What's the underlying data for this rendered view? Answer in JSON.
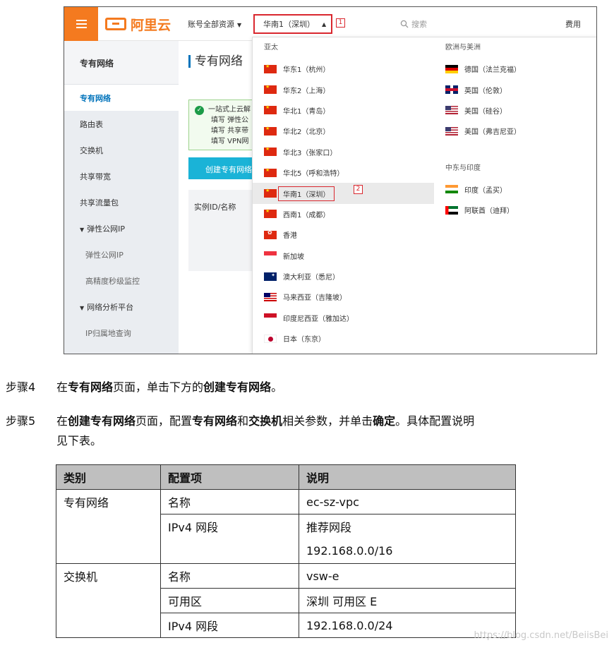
{
  "console": {
    "logo_text": "阿里云",
    "account_menu": "账号全部资源",
    "region_selector": "华南1（深圳）",
    "marker_1": "1",
    "marker_2": "2",
    "search_placeholder": "搜索",
    "fee_label": "费用",
    "brand_color": "#f47a1f",
    "sidebar": {
      "title": "专有网络",
      "items": [
        {
          "label": "专有网络",
          "active": true
        },
        {
          "label": "路由表"
        },
        {
          "label": "交换机"
        },
        {
          "label": "共享带宽"
        },
        {
          "label": "共享流量包"
        },
        {
          "label": "弹性公网IP",
          "group": true
        },
        {
          "label": "弹性公网IP",
          "sub": true
        },
        {
          "label": "高精度秒级监控",
          "sub": true
        },
        {
          "label": "网络分析平台",
          "group": true
        },
        {
          "label": "IP归属地查询",
          "sub": true
        }
      ]
    },
    "main": {
      "title": "专有网络",
      "notice_lines": [
        "一站式上云解",
        "填写 弹性公",
        "填写 共享带",
        "填写 VPN网"
      ],
      "create_button": "创建专有网络",
      "column_header": "实例ID/名称"
    },
    "dropdown": {
      "asia_title": "亚太",
      "asia": [
        {
          "label": "华东1（杭州）",
          "flag": "cn"
        },
        {
          "label": "华东2（上海）",
          "flag": "cn"
        },
        {
          "label": "华北1（青岛）",
          "flag": "cn"
        },
        {
          "label": "华北2（北京）",
          "flag": "cn"
        },
        {
          "label": "华北3（张家口）",
          "flag": "cn"
        },
        {
          "label": "华北5（呼和浩特）",
          "flag": "cn"
        },
        {
          "label": "华南1（深圳）",
          "flag": "cn",
          "selected": true
        },
        {
          "label": "西南1（成都）",
          "flag": "cn"
        },
        {
          "label": "香港",
          "flag": "hk"
        },
        {
          "label": "新加坡",
          "flag": "sg"
        },
        {
          "label": "澳大利亚（悉尼）",
          "flag": "au"
        },
        {
          "label": "马来西亚（吉隆坡）",
          "flag": "my"
        },
        {
          "label": "印度尼西亚（雅加达）",
          "flag": "id"
        },
        {
          "label": "日本（东京）",
          "flag": "jp"
        }
      ],
      "europe_title": "欧洲与美洲",
      "europe": [
        {
          "label": "德国（法兰克福）",
          "flag": "de"
        },
        {
          "label": "英国（伦敦）",
          "flag": "uk"
        },
        {
          "label": "美国（硅谷）",
          "flag": "us"
        },
        {
          "label": "美国（弗吉尼亚）",
          "flag": "us"
        }
      ],
      "mideast_title": "中东与印度",
      "mideast": [
        {
          "label": "印度（孟买）",
          "flag": "in"
        },
        {
          "label": "阿联酋（迪拜）",
          "flag": "ae"
        }
      ]
    }
  },
  "steps": {
    "step4": {
      "num": "步骤4",
      "t1": "在",
      "b1": "专有网络",
      "t2": "页面，单击下方的",
      "b2": "创建专有网络",
      "t3": "。"
    },
    "step5": {
      "num": "步骤5",
      "t1": "在",
      "b1": "创建专有网络",
      "t2": "页面，配置",
      "b2": "专有网络",
      "t3": "和",
      "b3": "交换机",
      "t4": "相关参数，并单击",
      "b4": "确定",
      "t5": "。具体配置说明",
      "line2": "见下表。"
    }
  },
  "table": {
    "headers": [
      "类别",
      "配置项",
      "说明"
    ],
    "rows": [
      {
        "cat": "专有网络",
        "item": "名称",
        "desc": "ec-sz-vpc"
      },
      {
        "cat": "",
        "item": "IPv4 网段",
        "desc": "推荐网段"
      },
      {
        "cat": "",
        "item": "",
        "desc": "192.168.0.0/16"
      },
      {
        "cat": "交换机",
        "item": "名称",
        "desc": "vsw-e"
      },
      {
        "cat": "",
        "item": "可用区",
        "desc": "深圳  可用区 E"
      },
      {
        "cat": "",
        "item": "IPv4 网段",
        "desc": "192.168.0.0/24"
      }
    ]
  },
  "watermark": "https://blog.csdn.net/BeiisBei"
}
